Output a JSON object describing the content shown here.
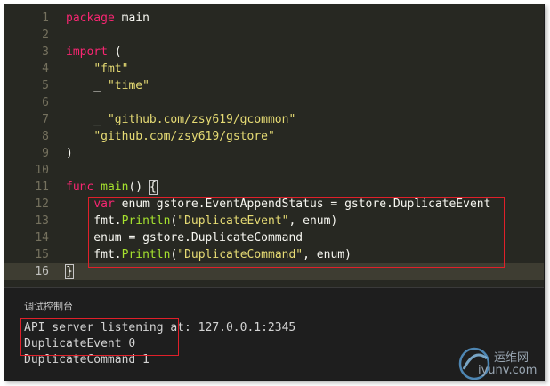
{
  "editor": {
    "lines": [
      {
        "n": "1",
        "segs": [
          {
            "c": "kw",
            "t": "package"
          },
          {
            "c": "punct",
            "t": " main"
          }
        ]
      },
      {
        "n": "2",
        "segs": []
      },
      {
        "n": "3",
        "segs": [
          {
            "c": "kw",
            "t": "import"
          },
          {
            "c": "punct",
            "t": " ("
          }
        ]
      },
      {
        "n": "4",
        "segs": [
          {
            "c": "punct",
            "t": "    "
          },
          {
            "c": "str",
            "t": "\"fmt\""
          }
        ]
      },
      {
        "n": "5",
        "segs": [
          {
            "c": "punct",
            "t": "    _ "
          },
          {
            "c": "str",
            "t": "\"time\""
          }
        ]
      },
      {
        "n": "6",
        "segs": []
      },
      {
        "n": "7",
        "segs": [
          {
            "c": "punct",
            "t": "    _ "
          },
          {
            "c": "str",
            "t": "\"github.com/zsy619/gcommon\""
          }
        ]
      },
      {
        "n": "8",
        "segs": [
          {
            "c": "punct",
            "t": "    "
          },
          {
            "c": "str",
            "t": "\"github.com/zsy619/gstore\""
          }
        ]
      },
      {
        "n": "9",
        "segs": [
          {
            "c": "punct",
            "t": ")"
          }
        ]
      },
      {
        "n": "10",
        "segs": []
      },
      {
        "n": "11",
        "segs": [
          {
            "c": "kw",
            "t": "func"
          },
          {
            "c": "punct",
            "t": " "
          },
          {
            "c": "fn",
            "t": "main"
          },
          {
            "c": "punct",
            "t": "() "
          },
          {
            "c": "punct brace-hl",
            "t": "{"
          }
        ]
      },
      {
        "n": "12",
        "segs": [
          {
            "c": "punct",
            "t": "    "
          },
          {
            "c": "kw",
            "t": "var"
          },
          {
            "c": "punct",
            "t": " enum gstore.EventAppendStatus = gstore.DuplicateEvent"
          }
        ]
      },
      {
        "n": "13",
        "segs": [
          {
            "c": "punct",
            "t": "    fmt."
          },
          {
            "c": "fn",
            "t": "Println"
          },
          {
            "c": "punct",
            "t": "("
          },
          {
            "c": "str",
            "t": "\"DuplicateEvent\""
          },
          {
            "c": "punct",
            "t": ", enum)"
          }
        ]
      },
      {
        "n": "14",
        "segs": [
          {
            "c": "punct",
            "t": "    enum = gstore.DuplicateCommand"
          }
        ]
      },
      {
        "n": "15",
        "segs": [
          {
            "c": "punct",
            "t": "    fmt."
          },
          {
            "c": "fn",
            "t": "Println"
          },
          {
            "c": "punct",
            "t": "("
          },
          {
            "c": "str",
            "t": "\"DuplicateCommand\""
          },
          {
            "c": "punct",
            "t": ", enum)"
          }
        ]
      },
      {
        "n": "16",
        "segs": [
          {
            "c": "punct brace-hl",
            "t": "}"
          }
        ]
      }
    ],
    "current_line": "16"
  },
  "console": {
    "title": "调试控制台",
    "lines": [
      "API server listening at: 127.0.0.1:2345",
      "DuplicateEvent 0",
      "DuplicateCommand 1"
    ]
  },
  "watermark": {
    "top_text": "运维网",
    "bottom_text": "iyunv.com"
  },
  "colors": {
    "editor_bg": "#272822",
    "keyword": "#f92672",
    "function": "#a6e22e",
    "string": "#e6db74",
    "highlight_box": "#e0202a"
  }
}
